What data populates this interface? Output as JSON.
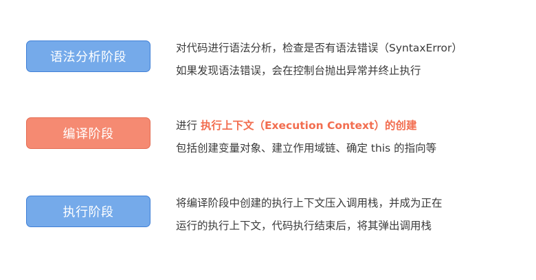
{
  "stages": [
    {
      "label": "语法分析阶段",
      "lines": [
        "对代码进行语法分析，检查是否有语法错误（SyntaxError）",
        "如果发现语法错误，会在控制台抛出异常并终止执行"
      ]
    },
    {
      "label": "编译阶段",
      "line1_prefix": "进行 ",
      "line1_highlight": "执行上下文（Execution Context）的创建",
      "line2": "包括创建变量对象、建立作用域链、确定 this 的指向等"
    },
    {
      "label": "执行阶段",
      "lines": [
        "将编译阶段中创建的执行上下文压入调用栈，并成为正在",
        "运行的执行上下文，代码执行结束后，将其弹出调用栈"
      ]
    }
  ],
  "colors": {
    "blue_box": "#75aaea",
    "orange_box": "#f58a72",
    "highlight_text": "#f26d4f"
  }
}
